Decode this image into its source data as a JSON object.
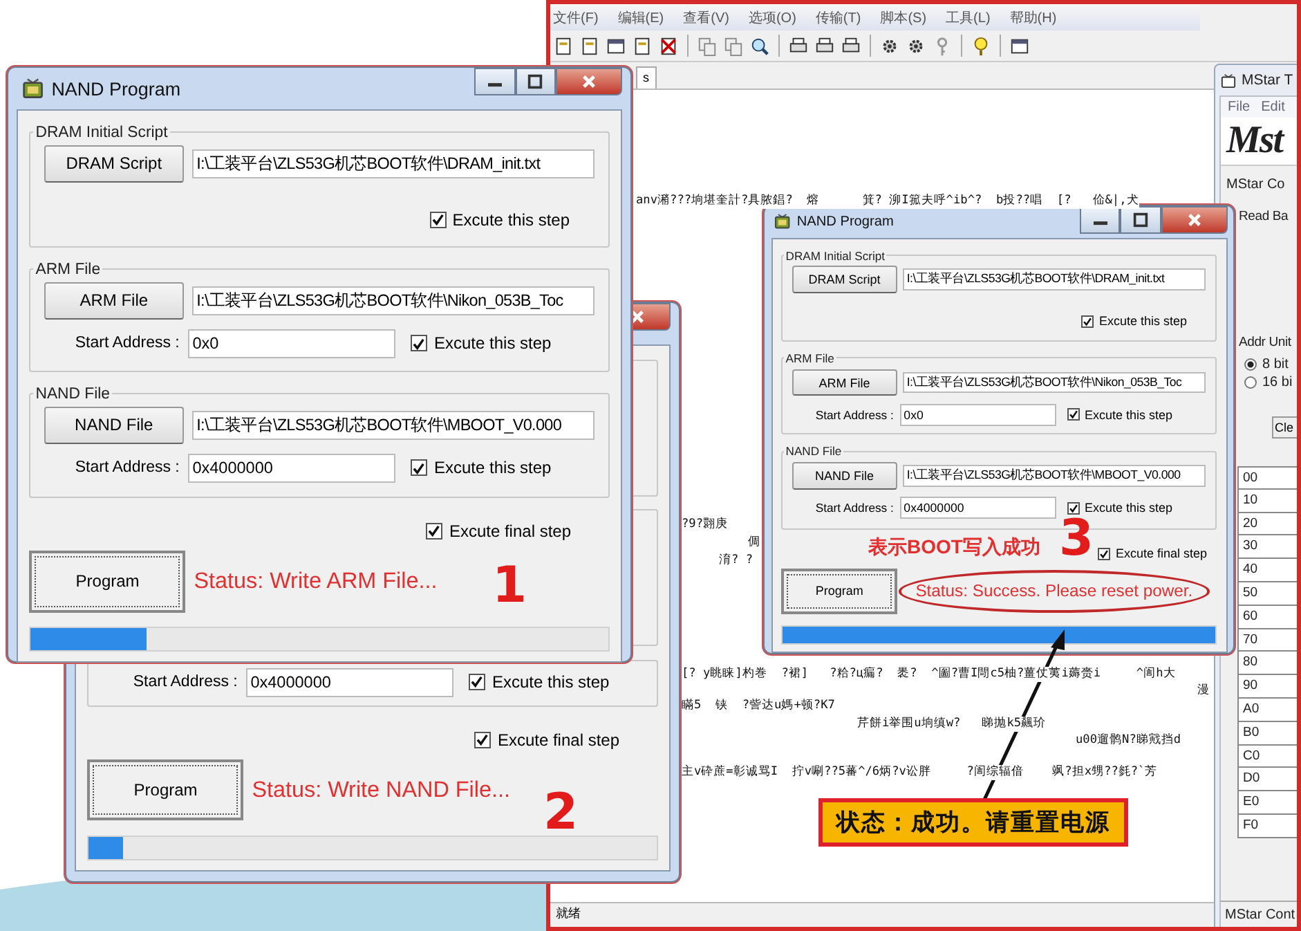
{
  "terminal": {
    "menu": [
      "文件(F)",
      "编辑(E)",
      "查看(V)",
      "选项(O)",
      "传输(T)",
      "脚本(S)",
      "工具(L)",
      "帮助(H)"
    ],
    "tab": "s",
    "lines": [
      "anv潲???垧堪奎計?具脓錩?  熔      箕? 泖I箛夫呼^ib^?  b投??唱  [?   佡&|,犬",
      "?9?翾庚",
      "倜",
      "淯? ?",
      "[? y眺睐]杓巻  ?裙]   ?粭?ц瘺?  褁?  ^圗?曹I閜c5柚?薑仗荑i薅赍i     ^訚h大",
      "漫",
      "瞞5  铗  ?訾达u媽+顿?K7",
      "芹餅i举围u垧缜w?   睇抛k5飆玠",
      "u00遛鹘N?睇戭挡d",
      "主v砕蔗=彰诚骂I  拧v唰??5蕃^/6炳?v讼胖     ?訚综辐偣    飒?担x甥??毵?`芳"
    ],
    "status": "就绪"
  },
  "mstar": {
    "title": "MStar T",
    "menu": [
      "File",
      "Edit"
    ],
    "logo": "Mst",
    "company": "MStar Co",
    "read": "Read Ba",
    "addr_unit": "Addr Unit",
    "options": [
      {
        "label": "8 bit",
        "selected": true
      },
      {
        "label": "16 bi",
        "selected": false
      }
    ],
    "clear_button": "Cle",
    "rows": [
      "00",
      "10",
      "20",
      "30",
      "40",
      "50",
      "60",
      "70",
      "80",
      "90",
      "A0",
      "B0",
      "C0",
      "D0",
      "E0",
      "F0"
    ],
    "footer": "MStar Cont"
  },
  "dialogs": [
    {
      "title": "NAND Program",
      "sections": [
        {
          "legend": "DRAM Initial Script",
          "button": "DRAM Script",
          "path": "I:\\工装平台\\ZLS53G机芯BOOT软件\\DRAM_init.txt",
          "execute": {
            "label": "Excute this step",
            "checked": true
          }
        },
        {
          "legend": "ARM File",
          "button": "ARM File",
          "path": "I:\\工装平台\\ZLS53G机芯BOOT软件\\Nikon_053B_Toc",
          "address_label": "Start Address :",
          "address": "0x0",
          "execute": {
            "label": "Excute this step",
            "checked": true
          }
        },
        {
          "legend": "NAND File",
          "button": "NAND File",
          "path": "I:\\工装平台\\ZLS53G机芯BOOT软件\\MBOOT_V0.000",
          "address_label": "Start Address :",
          "address": "0x4000000",
          "execute": {
            "label": "Excute this step",
            "checked": true
          }
        }
      ],
      "final_step": {
        "label": "Excute final step",
        "checked": true
      },
      "program_button": "Program",
      "status": "Status: Write ARM File...",
      "progress": {
        "level": 0.2
      }
    },
    {
      "sections": [
        {
          "address_label": "Start Address :",
          "address": "0x4000000",
          "execute": {
            "label": "Excute this step",
            "checked": true
          }
        }
      ],
      "final_step": {
        "label": "Excute final step",
        "checked": true
      },
      "program_button": "Program",
      "status": "Status: Write NAND File...",
      "progress": {
        "level": 0.06
      }
    },
    {
      "title": "NAND Program",
      "sections": [
        {
          "legend": "DRAM Initial Script",
          "button": "DRAM Script",
          "path": "I:\\工装平台\\ZLS53G机芯BOOT软件\\DRAM_init.txt",
          "execute": {
            "label": "Excute this step",
            "checked": true
          }
        },
        {
          "legend": "ARM File",
          "button": "ARM File",
          "path": "I:\\工装平台\\ZLS53G机芯BOOT软件\\Nikon_053B_Toc",
          "address_label": "Start Address :",
          "address": "0x0",
          "execute": {
            "label": "Excute this step",
            "checked": true
          }
        },
        {
          "legend": "NAND File",
          "button": "NAND File",
          "path": "I:\\工装平台\\ZLS53G机芯BOOT软件\\MBOOT_V0.000",
          "address_label": "Start Address :",
          "address": "0x4000000",
          "execute": {
            "label": "Excute this step",
            "checked": true
          }
        }
      ],
      "final_step": {
        "label": "Excute final step",
        "checked": true
      },
      "program_button": "Program",
      "status": "Status: Success. Please reset power.",
      "status_highlighted": true,
      "progress": {
        "level": 1
      }
    }
  ],
  "annotations": [
    {
      "kind": "number",
      "text": "1"
    },
    {
      "kind": "number",
      "text": "2"
    },
    {
      "kind": "caption",
      "text": "表示BOOT写入成功"
    },
    {
      "kind": "number",
      "text": "3"
    },
    {
      "kind": "callout",
      "text": "状态：成功。请重置电源"
    }
  ]
}
